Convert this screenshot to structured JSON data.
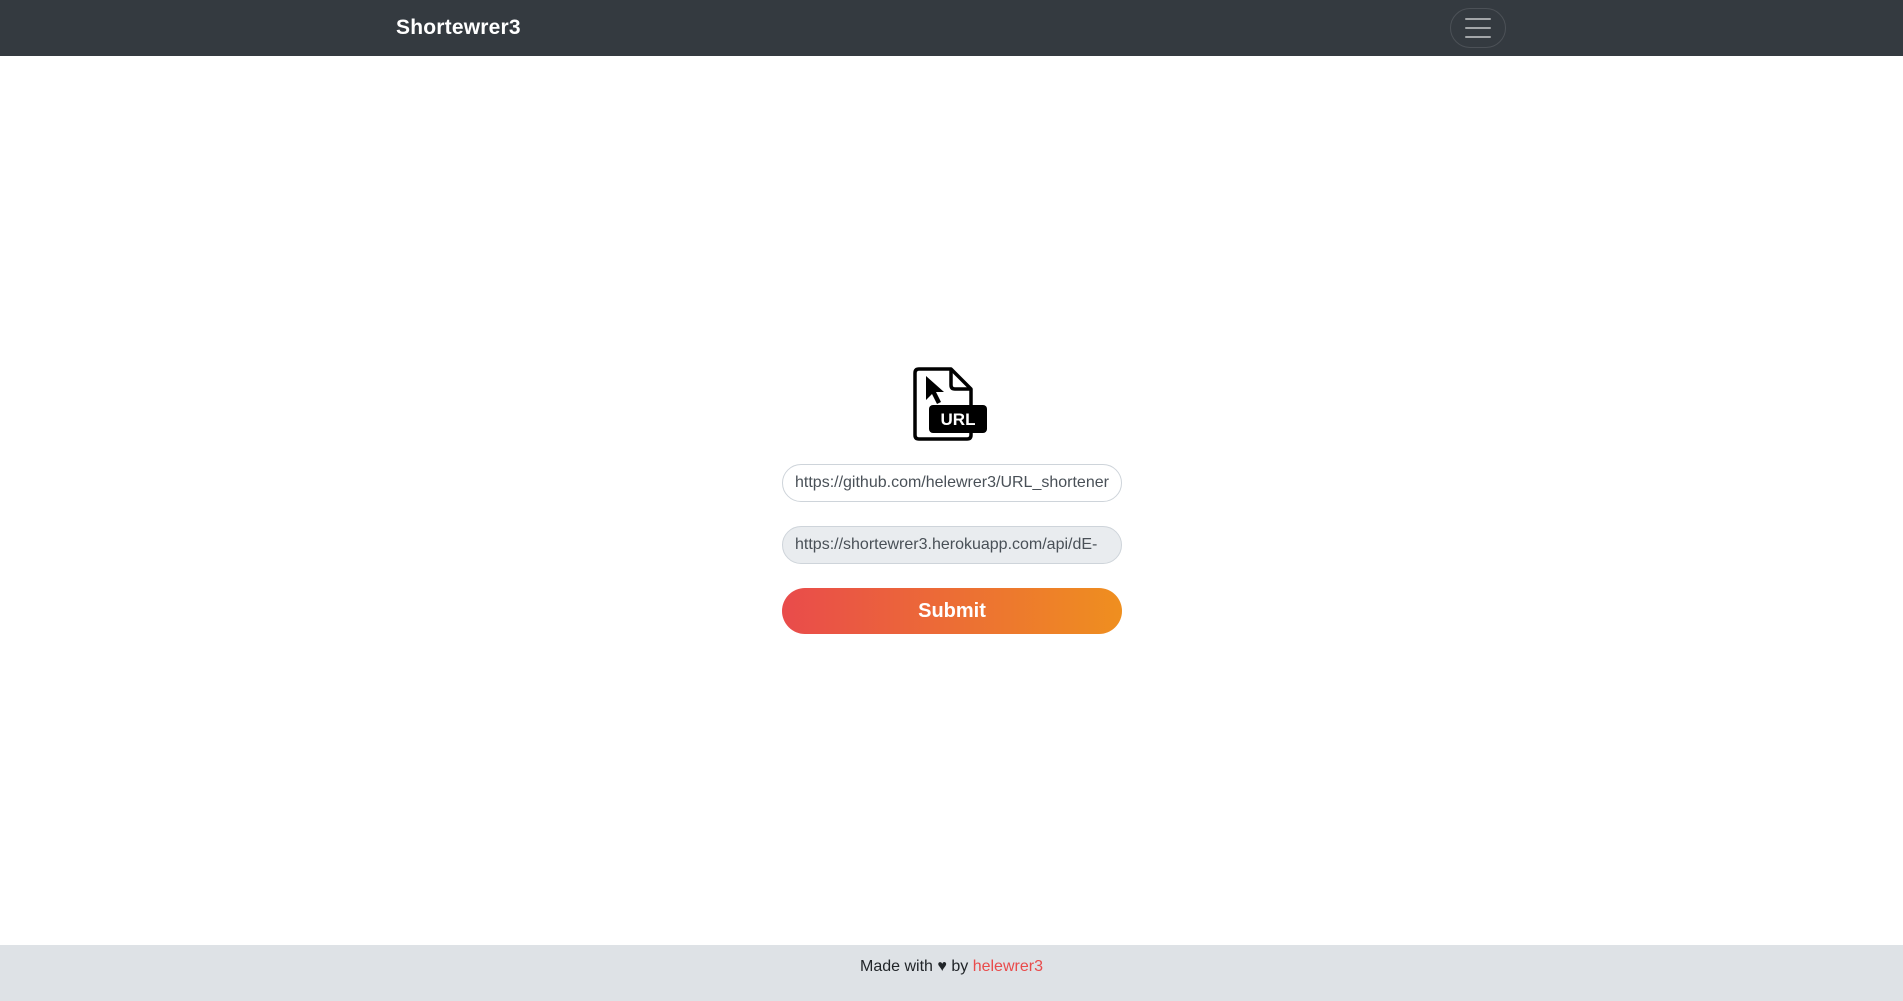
{
  "navbar": {
    "brand": "Shortewrer3",
    "toggler_icon": "hamburger-icon"
  },
  "main": {
    "logo_icon": "url-file-icon",
    "logo_text": "URL",
    "long_url": {
      "value": "https://github.com/helewrer3/URL_shortener"
    },
    "short_url": {
      "value": "https://shortewrer3.herokuapp.com/api/dE-"
    },
    "submit_label": "Submit"
  },
  "footer": {
    "prefix": "Made with ",
    "heart": "♥",
    "by": " by ",
    "author": "helewrer3"
  },
  "colors": {
    "navbar_bg": "#343a40",
    "footer_bg": "#dee2e6",
    "gradient_start": "#e94b4b",
    "gradient_end": "#ef8f1f",
    "link": "#e94b4b"
  }
}
